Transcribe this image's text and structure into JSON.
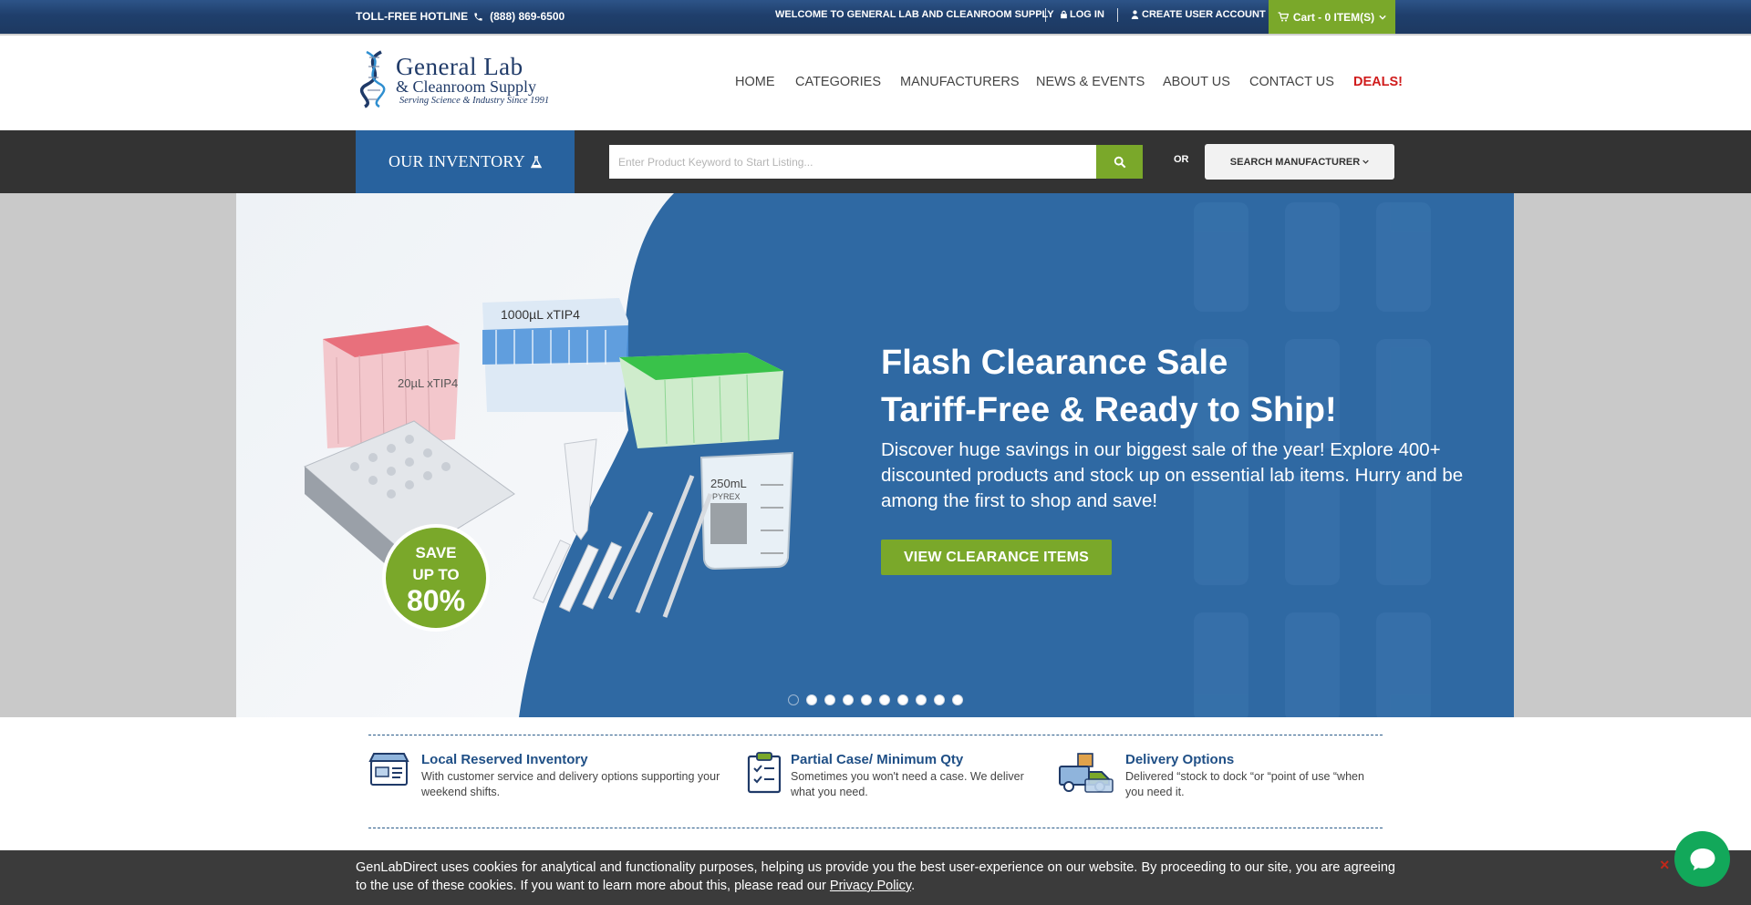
{
  "topbar": {
    "hotline_label": "TOLL-FREE HOTLINE",
    "hotline_number": "(888) 869-6500",
    "welcome": "WELCOME TO GENERAL LAB AND CLEANROOM SUPPLY",
    "login": "LOG IN",
    "create_account": "CREATE USER ACCOUNT",
    "cart": "Cart - 0 ITEM(S)"
  },
  "logo": {
    "line1": "General Lab",
    "line2": "& Cleanroom Supply",
    "tagline": "Serving Science & Industry Since 1991"
  },
  "nav": {
    "items": [
      "HOME",
      "CATEGORIES",
      "MANUFACTURERS",
      "NEWS & EVENTS",
      "ABOUT US",
      "CONTACT US"
    ],
    "deals": "DEALS!"
  },
  "search": {
    "inventory_label": "OUR INVENTORY",
    "placeholder": "Enter Product Keyword to Start Listing...",
    "or_label": "OR",
    "manufacturer_button": "SEARCH MANUFACTURER"
  },
  "hero": {
    "headline_1": "Flash Clearance Sale",
    "headline_2": "Tariff-Free & Ready to Ship!",
    "description": "Discover huge savings in our biggest sale of the year! Explore 400+ discounted products and stock up on essential lab items. Hurry and be among the first to shop and save!",
    "cta": "VIEW CLEARANCE ITEMS",
    "badge_line1": "SAVE",
    "badge_line2": "UP TO",
    "badge_line3": "80%",
    "product_labels": {
      "tip1": "1000µL xTIP4",
      "tip2": "20µL xTIP4",
      "beaker": "250mL",
      "beaker_brand": "PYREX"
    },
    "slide_count": 10,
    "active_slide": 1
  },
  "features": [
    {
      "title": "Local Reserved Inventory",
      "description": "With customer service and delivery options supporting your weekend shifts."
    },
    {
      "title": "Partial Case/ Minimum Qty",
      "description": "Sometimes you won't need a case. We deliver what you need."
    },
    {
      "title": "Delivery Options",
      "description": "Delivered “stock to dock “or “point of use “when you need it."
    }
  ],
  "cookie": {
    "text": "GenLabDirect uses cookies for analytical and functionality purposes, helping us provide you the best user-experience on our website. By proceeding to our site, you are agreeing to the use of these cookies. If you want to learn more about this, please read our",
    "link": "Privacy Policy",
    "end": ".",
    "close": "×"
  },
  "colors": {
    "brand_blue": "#1f3a68",
    "hero_blue": "#2f69a3",
    "accent_green": "#7aa82a",
    "deals_red": "#d01c1c",
    "chat_green": "#12a85a"
  }
}
